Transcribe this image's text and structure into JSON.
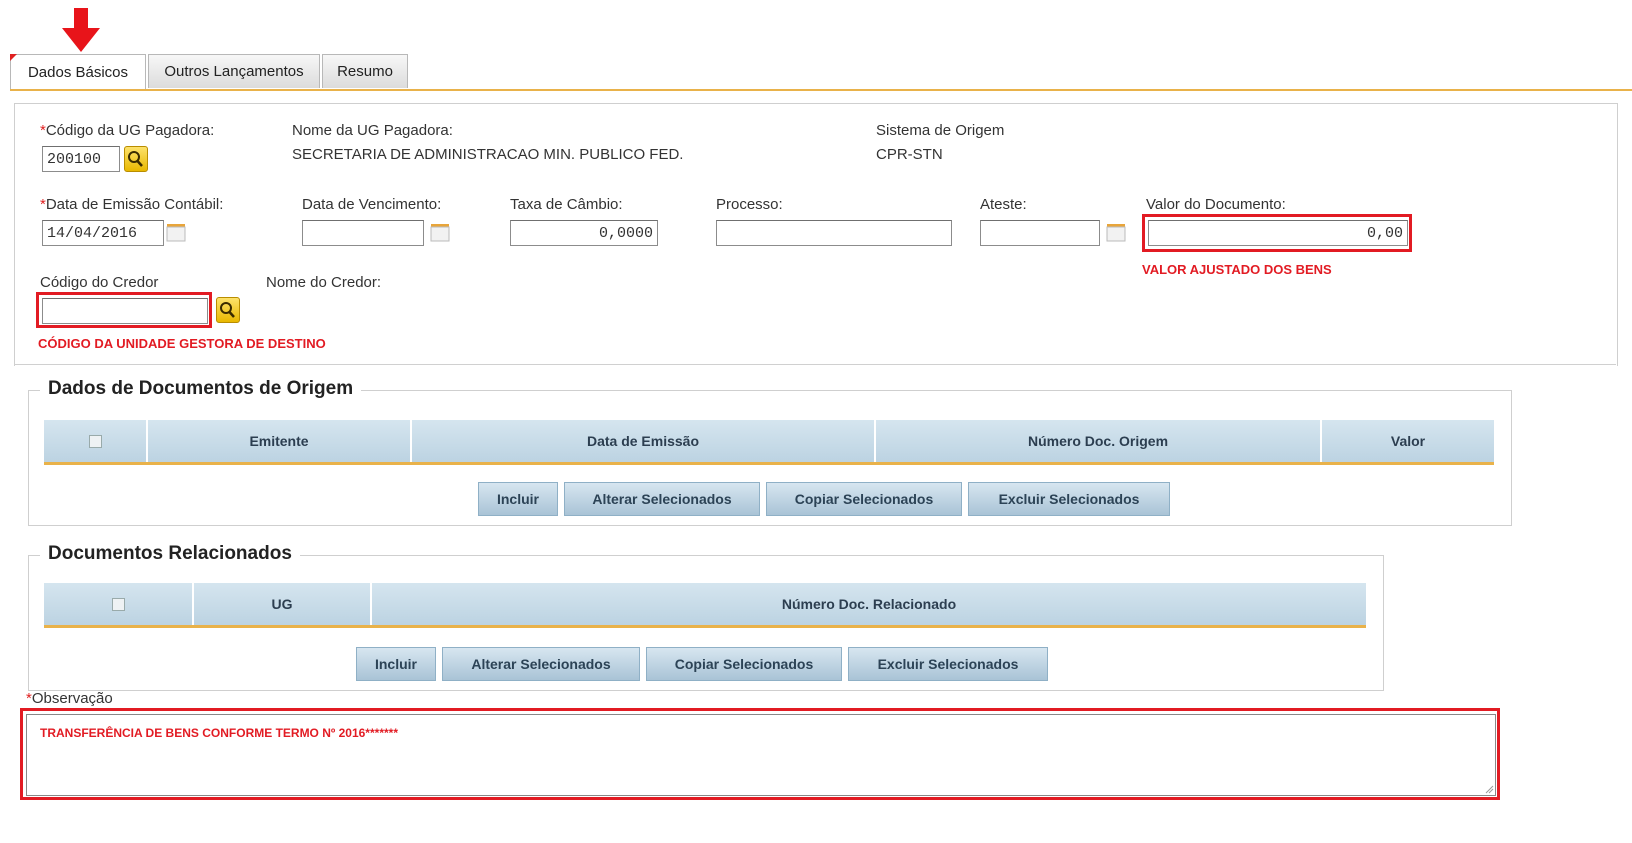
{
  "tabs": [
    {
      "label": "Dados Básicos"
    },
    {
      "label": "Outros Lançamentos"
    },
    {
      "label": "Resumo"
    }
  ],
  "ug_pagadora": {
    "code_label": "Código da UG Pagadora:",
    "code_value": "200100",
    "name_label": "Nome da UG Pagadora:",
    "name_value": "SECRETARIA DE ADMINISTRACAO MIN. PUBLICO FED.",
    "sistema_label": "Sistema de Origem",
    "sistema_value": "CPR-STN"
  },
  "dates": {
    "emissao_label": "Data de Emissão Contábil:",
    "emissao_value": "14/04/2016",
    "vencimento_label": "Data de Vencimento:",
    "vencimento_value": "",
    "taxa_label": "Taxa de Câmbio:",
    "taxa_value": "0,0000",
    "processo_label": "Processo:",
    "processo_value": "",
    "ateste_label": "Ateste:",
    "ateste_value": "",
    "valor_label": "Valor do Documento:",
    "valor_value": "0,00",
    "valor_note": "VALOR AJUSTADO DOS BENS"
  },
  "credor": {
    "code_label": "Código do Credor",
    "code_value": "",
    "name_label": "Nome do Credor:",
    "code_note": "CÓDIGO DA UNIDADE GESTORA DE DESTINO"
  },
  "origem": {
    "legend": "Dados de Documentos de Origem",
    "columns": [
      "Emitente",
      "Data de Emissão",
      "Número Doc. Origem",
      "Valor"
    ],
    "buttons": [
      "Incluir",
      "Alterar Selecionados",
      "Copiar Selecionados",
      "Excluir Selecionados"
    ]
  },
  "relacionados": {
    "legend": "Documentos Relacionados",
    "columns": [
      "UG",
      "Número Doc. Relacionado"
    ],
    "buttons": [
      "Incluir",
      "Alterar Selecionados",
      "Copiar Selecionados",
      "Excluir Selecionados"
    ]
  },
  "observacao": {
    "label": "Observação",
    "value": "TRANSFERÊNCIA DE BENS CONFORME TERMO Nº 2016*******"
  },
  "colors": {
    "highlight_red": "#e21b23",
    "tab_accent": "#e9b24a",
    "table_header": "#bcd3e2"
  },
  "icons": {
    "search": "search-icon",
    "calendar": "calendar-icon",
    "arrow": "arrow-down-icon"
  }
}
